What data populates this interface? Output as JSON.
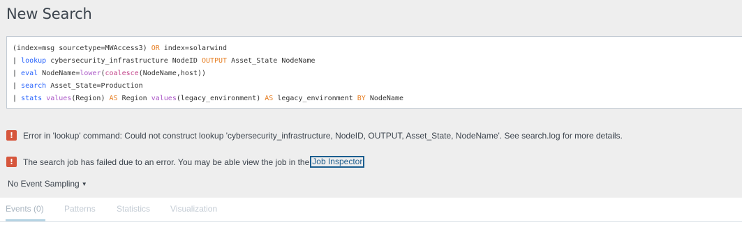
{
  "page": {
    "title": "New Search"
  },
  "query": {
    "line1": {
      "a": "(index=msg sourcetype=MWAccess3) ",
      "or": "OR",
      "b": " index=solarwind"
    },
    "line2": {
      "pipe": "| ",
      "cmd": "lookup",
      "a": " cybersecurity_infrastructure NodeID ",
      "output": "OUTPUT",
      "b": " Asset_State NodeName"
    },
    "line3": {
      "pipe": "| ",
      "cmd": "eval",
      "a": " NodeName=",
      "fn1": "lower",
      "paren1": "(",
      "fn2": "coalesce",
      "b": "(NodeName,host))"
    },
    "line4": {
      "pipe": "| ",
      "cmd": "search",
      "a": " Asset_State=Production"
    },
    "line5": {
      "pipe": "| ",
      "cmd": "stats",
      "sp": " ",
      "fn1": "values",
      "a": "(Region) ",
      "as1": "AS",
      "b": " Region ",
      "fn2": "values",
      "c": "(legacy_environment) ",
      "as2": "AS",
      "d": " legacy_environment ",
      "by": "BY",
      "e": " NodeName"
    }
  },
  "errors": {
    "icon_symbol": "!",
    "icon_name": "exclamation-icon",
    "icon_color": "#d6563c",
    "lookup_error": "Error in 'lookup' command: Could not construct lookup 'cybersecurity_infrastructure, NodeID, OUTPUT, Asset_State, NodeName'. See search.log for more details.",
    "job_failed_text": "The search job has failed due to an error. You may be able view the job in the",
    "job_inspector_link": "Job Inspector"
  },
  "sampling": {
    "label": "No Event Sampling",
    "caret": "▼"
  },
  "tabs": [
    {
      "label": "Events (0)",
      "active": true
    },
    {
      "label": "Patterns",
      "active": false
    },
    {
      "label": "Statistics",
      "active": false
    },
    {
      "label": "Visualization",
      "active": false
    }
  ]
}
